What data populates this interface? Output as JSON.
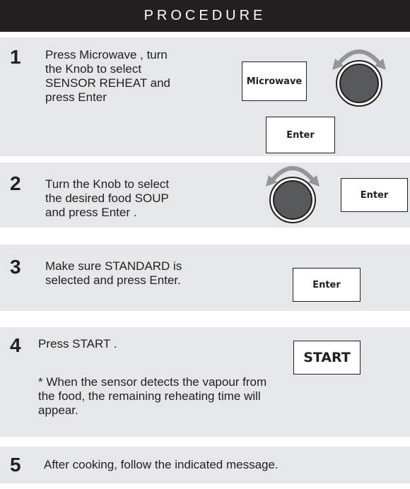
{
  "header": {
    "title": "PROCEDURE"
  },
  "steps": [
    {
      "number": "1",
      "lines": [
        "Press Microwave , turn",
        "the Knob to select",
        "SENSOR REHEAT and",
        "press Enter"
      ],
      "buttons": {
        "microwave": "Microwave",
        "enter": "Enter"
      }
    },
    {
      "number": "2",
      "lines": [
        "Turn the Knob to select",
        "the desired food SOUP",
        "and press Enter ."
      ],
      "buttons": {
        "enter": "Enter"
      }
    },
    {
      "number": "3",
      "lines": [
        "Make sure STANDARD is",
        "selected and press Enter."
      ],
      "buttons": {
        "enter": "Enter"
      }
    },
    {
      "number": "4",
      "lines": [
        "Press START ."
      ],
      "note": [
        "* When the sensor detects the vapour from",
        "the food, the remaining reheating time will",
        "appear."
      ],
      "buttons": {
        "start": "START"
      }
    },
    {
      "number": "5",
      "lines": [
        "After cooking, follow the indicated message."
      ]
    }
  ],
  "colors": {
    "header_bg": "#231f20",
    "step_bg": "#e6e7e8",
    "text": "#231f20",
    "knob": "#58595b"
  },
  "icons": [
    "knob-icon",
    "rotate-arrow-icon"
  ]
}
